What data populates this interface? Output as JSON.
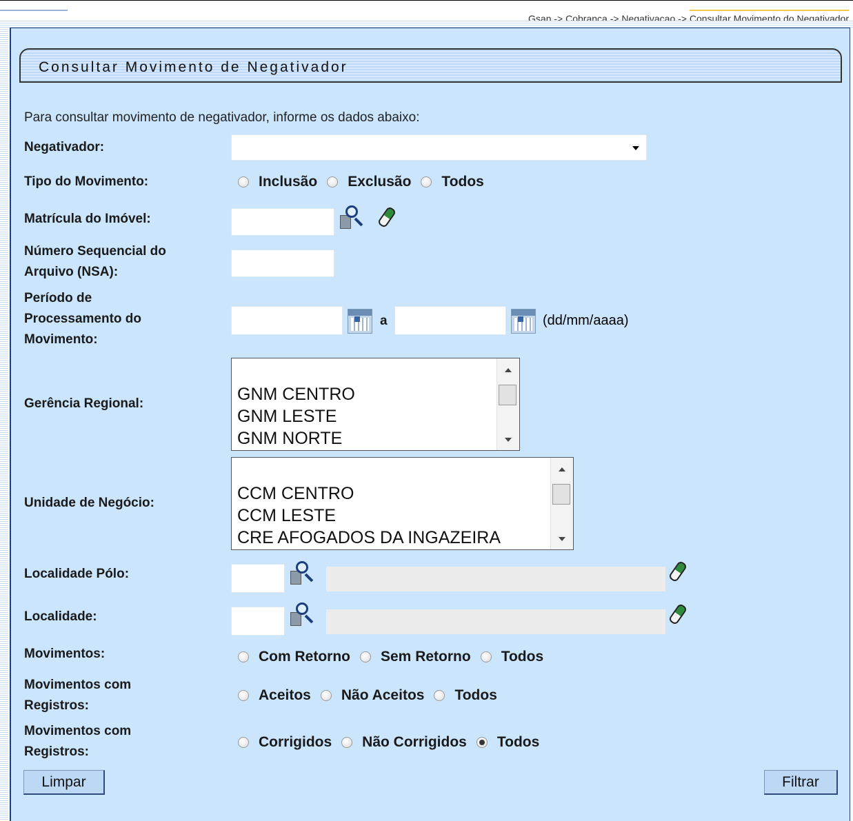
{
  "breadcrumb": "Gsan -> Cobranca -> Negativacao -> ",
  "breadcrumb_last": "Consultar Movimento do Negativador",
  "title": "Consultar Movimento de Negativador",
  "intro": "Para consultar movimento de negativador, informe os dados abaixo:",
  "fields": {
    "negativador_label": "Negativador:",
    "negativador_value": "",
    "tipo_label": "Tipo do Movimento:",
    "tipo_options": [
      "Inclusão",
      "Exclusão",
      "Todos"
    ],
    "matricula_label": "Matrícula do Imóvel:",
    "matricula_value": "",
    "nsa_label_1": "Número Sequencial do",
    "nsa_label_2": "Arquivo (NSA):",
    "nsa_value": "",
    "periodo_label_1": "Período de",
    "periodo_label_2": "Processamento do",
    "periodo_label_3": "Movimento:",
    "periodo_start": "",
    "periodo_sep": "a",
    "periodo_end": "",
    "periodo_format": "(dd/mm/aaaa)",
    "gerencia_label": "Gerência Regional:",
    "gerencia_items": [
      "",
      "GNM CENTRO",
      "GNM LESTE",
      "GNM NORTE"
    ],
    "unidade_label": "Unidade de Negócio:",
    "unidade_items": [
      "",
      "CCM CENTRO",
      "CCM LESTE",
      "CRE AFOGADOS DA INGAZEIRA"
    ],
    "localidade_polo_label": "Localidade Pólo:",
    "localidade_polo_code": "",
    "localidade_polo_name": "",
    "localidade_label": "Localidade:",
    "localidade_code": "",
    "localidade_name": "",
    "movimentos_label": "Movimentos:",
    "movimentos_options": [
      "Com Retorno",
      "Sem Retorno",
      "Todos"
    ],
    "mov_reg_label_1": "Movimentos com",
    "mov_reg_label_2": "Registros:",
    "mov_reg_options": [
      "Aceitos",
      "Não Aceitos",
      "Todos"
    ],
    "mov_reg2_label_1": "Movimentos com",
    "mov_reg2_label_2": "Registros:",
    "mov_reg2_options": [
      "Corrigidos",
      "Não Corrigidos",
      "Todos"
    ],
    "mov_reg2_selected": "Todos"
  },
  "buttons": {
    "limpar": "Limpar",
    "filtrar": "Filtrar"
  }
}
